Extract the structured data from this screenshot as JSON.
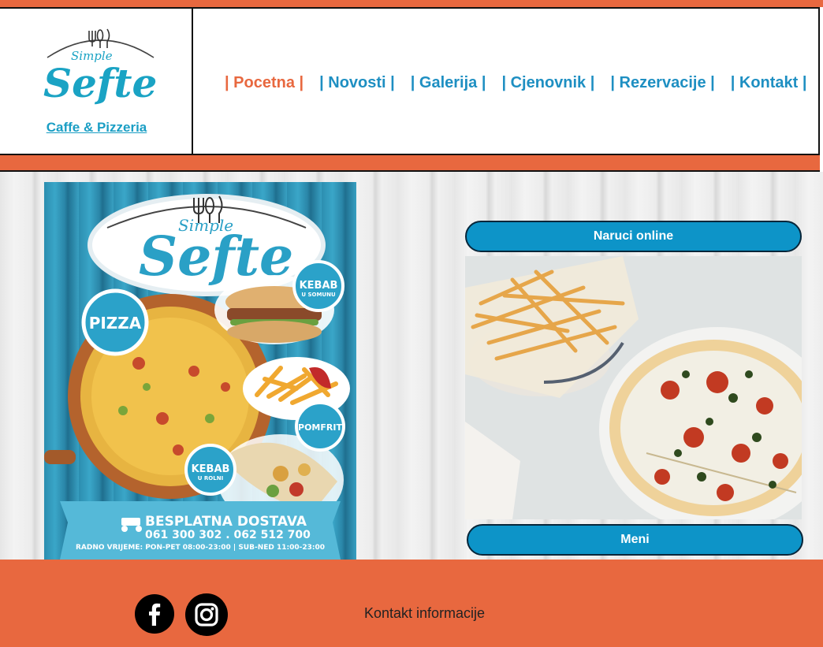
{
  "brand": {
    "logo_small_text": "Simple",
    "logo_large_text": "Sefte",
    "subtitle": "Caffe & Pizzeria"
  },
  "nav": {
    "items": [
      {
        "label": "| Pocetna |",
        "active": true
      },
      {
        "label": "| Novosti |",
        "active": false
      },
      {
        "label": "| Galerija |",
        "active": false
      },
      {
        "label": "| Cjenovnik |",
        "active": false
      },
      {
        "label": "| Rezervacije |",
        "active": false
      },
      {
        "label": "| Kontakt |",
        "active": false
      }
    ]
  },
  "poster": {
    "logo_small_text": "Simple",
    "logo_large_text": "Sefte",
    "badge_pizza": "PIZZA",
    "badge_kebab_somun_title": "KEBAB",
    "badge_kebab_somun_sub": "U SOMUNU",
    "badge_pomfrit": "POMFRIT",
    "badge_kebab_rolni_title": "KEBAB",
    "badge_kebab_rolni_sub": "U ROLNI",
    "delivery_title": "BESPLATNA DOSTAVA",
    "phones": "061 300 302 . 062 512 700",
    "hours": "RADNO VRIJEME: PON-PET 08:00-23:00 | SUB-NED 11:00-23:00"
  },
  "actions": {
    "order_online": "Naruci online",
    "menu": "Meni"
  },
  "footer": {
    "contact_label": "Kontakt informacije"
  },
  "colors": {
    "accent": "#e8683f",
    "brand_blue": "#1e8fc2",
    "button_blue": "#0d94c8"
  },
  "icons": [
    "facebook-icon",
    "instagram-icon"
  ]
}
